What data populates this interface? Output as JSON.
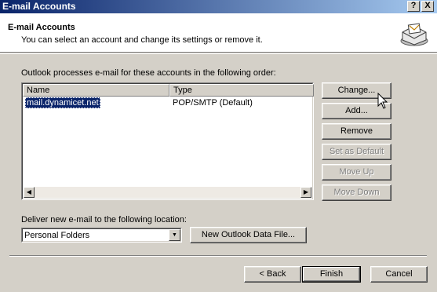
{
  "window": {
    "title": "E-mail Accounts",
    "help_button": "?",
    "close_button": "X"
  },
  "header": {
    "title": "E-mail Accounts",
    "subtitle": "You can select an account and change its settings or remove it.",
    "icon": "mail-accounts-icon"
  },
  "accounts": {
    "instruction": "Outlook processes e-mail for these accounts in the following order:",
    "columns": [
      "Name",
      "Type"
    ],
    "rows": [
      {
        "name": "mail.dynamicet.net",
        "type": "POP/SMTP (Default)",
        "selected": true
      }
    ]
  },
  "side_buttons": {
    "change": "Change...",
    "add": "Add...",
    "remove": "Remove",
    "set_default": "Set as Default",
    "move_up": "Move Up",
    "move_down": "Move Down"
  },
  "delivery": {
    "label": "Deliver new e-mail to the following location:",
    "selected": "Personal Folders",
    "new_data_file": "New Outlook Data File..."
  },
  "footer": {
    "back": "< Back",
    "finish": "Finish",
    "cancel": "Cancel"
  }
}
